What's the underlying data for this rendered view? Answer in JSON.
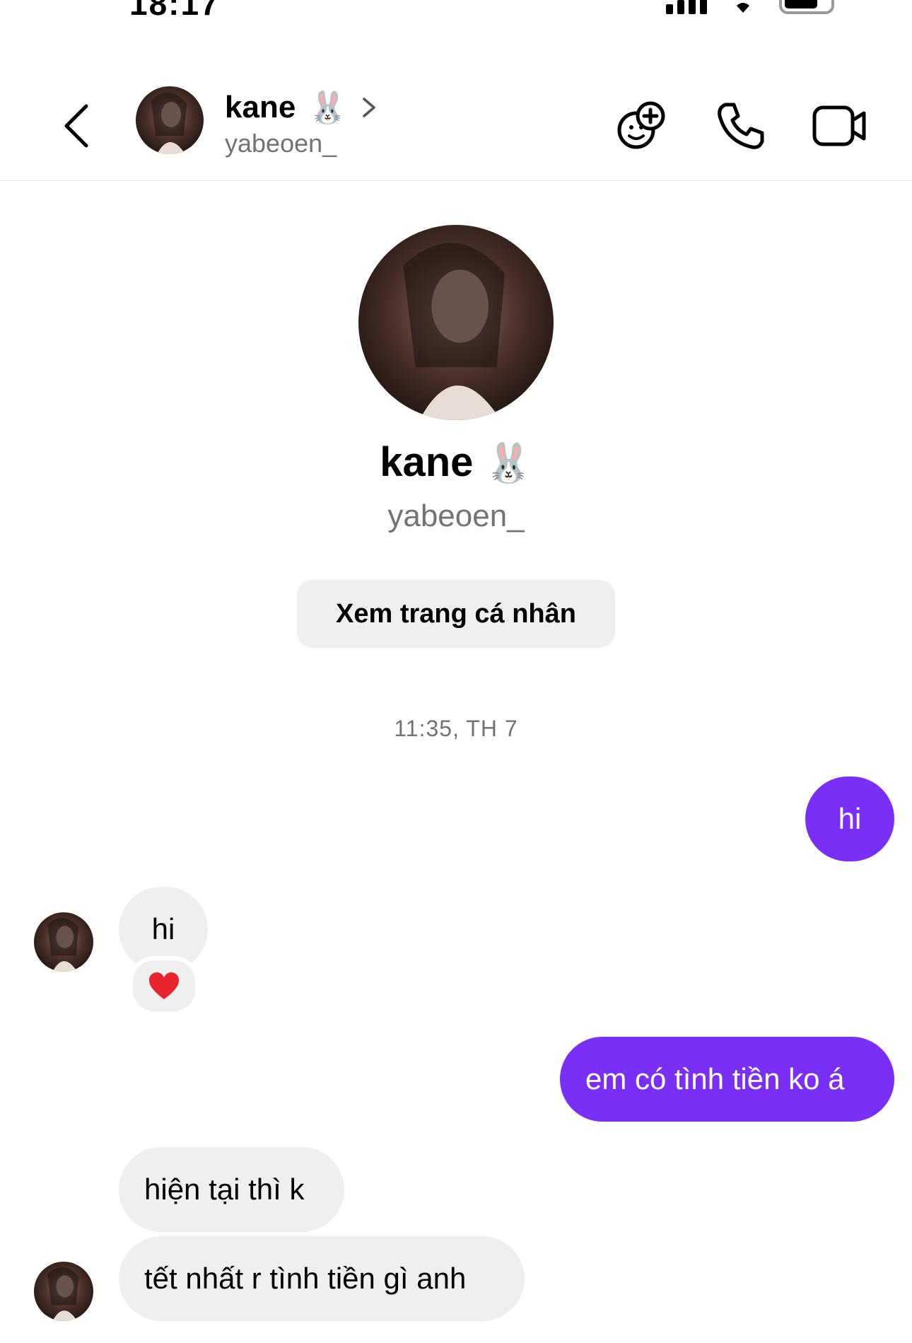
{
  "status_bar": {
    "time": "18:17"
  },
  "header": {
    "name": "kane",
    "emoji": "🐰",
    "handle": "yabeoen_"
  },
  "profile": {
    "name": "kane",
    "emoji": "🐰",
    "handle": "yabeoen_",
    "view_profile_label": "Xem trang cá nhân"
  },
  "conversation": {
    "timestamp": "11:35, TH 7",
    "messages": [
      {
        "direction": "outgoing",
        "text": "hi"
      },
      {
        "direction": "incoming",
        "text": "hi",
        "reaction": "❤️"
      },
      {
        "direction": "outgoing",
        "text": "em có tình tiền ko á"
      },
      {
        "direction": "incoming",
        "text": "hiện tại thì k"
      },
      {
        "direction": "incoming",
        "text": "tết nhất r tình tiền gì anh"
      }
    ]
  },
  "colors": {
    "outgoing_bubble": "#7a2ff7",
    "incoming_bubble": "#efefef",
    "secondary_text": "#737373"
  },
  "icons": [
    "back-arrow-icon",
    "chevron-right-icon",
    "add-people-icon",
    "phone-icon",
    "video-camera-icon",
    "heart-icon"
  ]
}
